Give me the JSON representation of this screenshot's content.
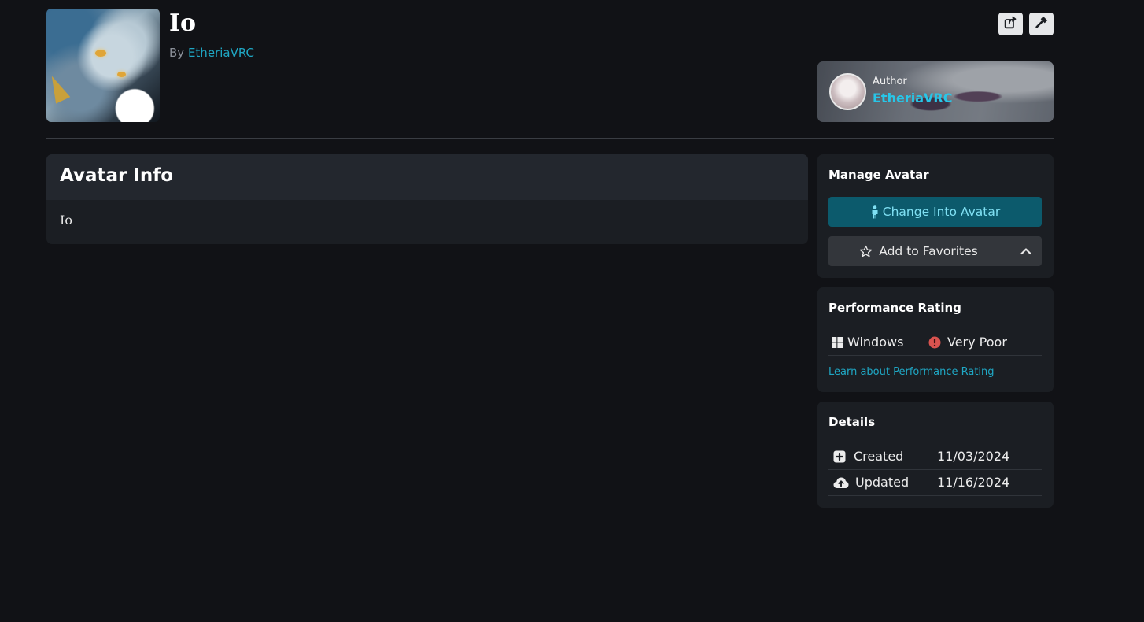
{
  "header": {
    "title": "Io",
    "by_label": "By",
    "author_link": "EtheriaVRC"
  },
  "toolbar": {
    "share_icon": "share-icon",
    "tool_icon": "hammer-icon"
  },
  "author_card": {
    "label": "Author",
    "name": "EtheriaVRC"
  },
  "avatar_info": {
    "title": "Avatar Info",
    "description": "Io"
  },
  "manage": {
    "title": "Manage Avatar",
    "change_label": "Change Into Avatar",
    "favorite_label": "Add to Favorites"
  },
  "performance": {
    "title": "Performance Rating",
    "platform": "Windows",
    "rating": "Very Poor",
    "learn_link": "Learn about Performance Rating"
  },
  "details": {
    "title": "Details",
    "rows": [
      {
        "label": "Created",
        "value": "11/03/2024"
      },
      {
        "label": "Updated",
        "value": "11/16/2024"
      }
    ]
  },
  "colors": {
    "background": "#111216",
    "accent": "#1fa7c4",
    "change_button": "#0c5a6c",
    "very_poor": "#d9534f"
  }
}
